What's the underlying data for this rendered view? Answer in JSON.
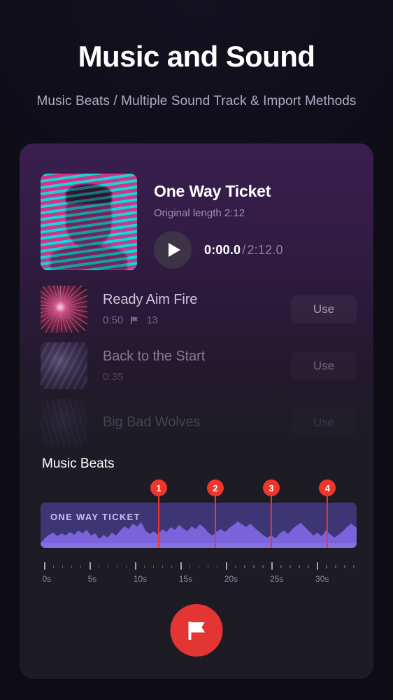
{
  "header": {
    "title": "Music and Sound",
    "subtitle": "Music Beats / Multiple Sound Track & Import Methods"
  },
  "now_playing": {
    "title": "One Way Ticket",
    "original_length_label": "Original length 2:12",
    "play_icon": "play-icon",
    "current_time": "0:00.0",
    "separator": "/",
    "total_time": "2:12.0"
  },
  "track_list": [
    {
      "title": "Ready Aim Fire",
      "duration": "0:50",
      "beat_icon": "flag-icon",
      "beat_count": "13",
      "action_label": "Use"
    },
    {
      "title": "Back to the Start",
      "duration": "0:35",
      "beat_count": "",
      "action_label": "Use"
    },
    {
      "title": "Big Bad Wolves",
      "duration": "",
      "beat_count": "",
      "action_label": "Use"
    }
  ],
  "beats_section": {
    "heading": "Music Beats",
    "waveform_label": "ONE WAY TICKET",
    "markers": [
      {
        "number": "1",
        "pct": 37.4
      },
      {
        "number": "2",
        "pct": 55.3
      },
      {
        "number": "3",
        "pct": 73.0
      },
      {
        "number": "4",
        "pct": 90.8
      }
    ],
    "ruler": {
      "labels": [
        "0s",
        "5s",
        "10s",
        "15s",
        "20s",
        "25s",
        "30s"
      ],
      "major_pct": [
        1.0,
        15.4,
        29.8,
        44.2,
        58.6,
        73.0,
        87.4
      ],
      "minor_step_pct": 2.88
    },
    "add_beat_button_icon": "flag-icon"
  },
  "colors": {
    "accent_red": "#f0352d",
    "fab_red": "#e43535",
    "wave_panel": "#3e3674",
    "wave_fill": "#7b63dc",
    "page_bg": "#0e0d16",
    "card_bg": "#1d1c24"
  }
}
